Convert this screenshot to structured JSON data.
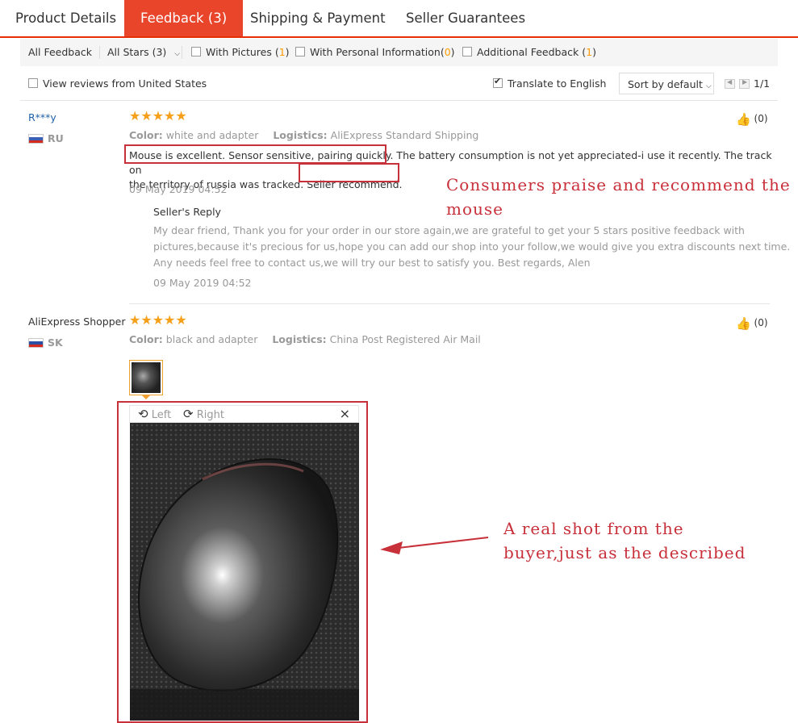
{
  "tabs": [
    {
      "label": "Product Details"
    },
    {
      "label": "Feedback (3)"
    },
    {
      "label": "Shipping & Payment"
    },
    {
      "label": "Seller Guarantees"
    }
  ],
  "filters": {
    "all_feedback": "All Feedback",
    "all_stars": "All Stars (3)",
    "with_pictures": "With Pictures (",
    "with_pictures_count": "1",
    "with_personal": "With Personal Information(",
    "with_personal_count": "0",
    "additional": "Additional Feedback (",
    "additional_count": "1",
    "close_paren": ")"
  },
  "options": {
    "view_us": "View reviews from United States",
    "translate": "Translate to English",
    "translate_checked": true,
    "sort": "Sort by default",
    "page": "1/1"
  },
  "reviews": [
    {
      "name": "R***y",
      "country": "RU",
      "stars": "★★★★★",
      "color_label": "Color:",
      "color_value": "white and adapter",
      "logistics_label": "Logistics:",
      "logistics_value": "AliExpress Standard Shipping",
      "text_line1": "Mouse is excellent. Sensor sensitive, pairing quickly. The battery consumption is not yet appreciated-i use it recently. The track on",
      "text_line2": "the territory of russia was tracked. Seller recommend.",
      "date": "09 May 2019 04:52",
      "helpful": "(0)",
      "reply_title": "Seller's Reply",
      "reply_line1": "My dear friend, Thank you for your order in our store again,we are grateful to get your 5 stars positive feedback with",
      "reply_line2": "pictures,because it's precious for us,hope you can add our shop into your follow,we would give you extra discounts next time.",
      "reply_line3": "Any needs feel free to contact us,we will try our best to satisfy you. Best regards, Alen",
      "reply_date": "09 May 2019 04:52"
    },
    {
      "name": "AliExpress Shopper",
      "country": "SK",
      "stars": "★★★★★",
      "color_label": "Color:",
      "color_value": "black and adapter",
      "logistics_label": "Logistics:",
      "logistics_value": "China Post Registered Air Mail",
      "helpful": "(0)"
    }
  ],
  "viewer": {
    "left": "Left",
    "right": "Right",
    "close": "×"
  },
  "annotations": {
    "praise_line1": "Consumers praise and recommend the",
    "praise_line2": "mouse",
    "real_line1": "A real shot from the",
    "real_line2": "buyer,just as the described"
  },
  "colors": {
    "accent": "#e62e04",
    "star": "#f6a01a",
    "annotation": "#c8303a"
  }
}
